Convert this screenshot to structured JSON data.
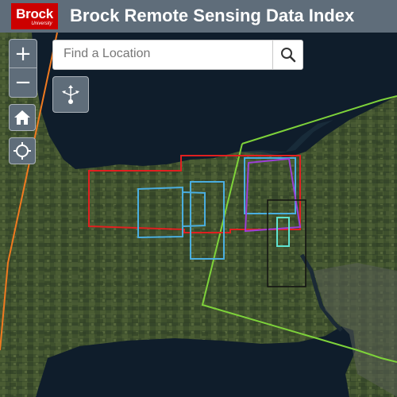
{
  "header": {
    "logo_text": "Brock",
    "logo_subtext": "University",
    "title": "Brock Remote Sensing Data Index"
  },
  "search": {
    "placeholder": "Find a Location",
    "value": ""
  },
  "controls": {
    "zoom_in_label": "+",
    "zoom_out_label": "−"
  },
  "colors": {
    "header": "#5f6d7a",
    "logo": "#cc0000",
    "lake": "#0f1d2b",
    "land": "#3d4f2c",
    "footprint_red": "#e02020",
    "footprint_blue": "#4aaee0",
    "footprint_purple": "#9b3fd6",
    "footprint_black": "#111111",
    "footprint_cyan": "#5fe3d0",
    "footprint_green": "#7ed23a",
    "footprint_orange": "#f07a20"
  },
  "icons": [
    "search-icon",
    "share-icon",
    "home-icon",
    "locate-icon",
    "zoom-in-icon",
    "zoom-out-icon"
  ]
}
